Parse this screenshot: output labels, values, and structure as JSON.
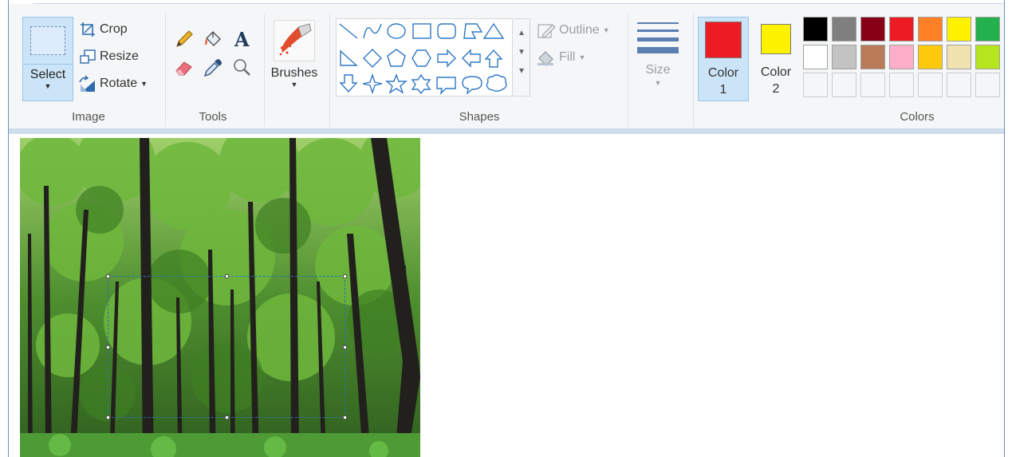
{
  "ribbon": {
    "image_group": {
      "label": "Image",
      "select_label": "Select",
      "crop_label": "Crop",
      "resize_label": "Resize",
      "rotate_label": "Rotate"
    },
    "tools_group": {
      "label": "Tools"
    },
    "brushes_label": "Brushes",
    "shapes_group": {
      "label": "Shapes",
      "outline_label": "Outline",
      "fill_label": "Fill"
    },
    "size_label": "Size",
    "colors_group": {
      "label": "Colors",
      "color1_label": "Color",
      "color1_num": "1",
      "color2_label": "Color",
      "color2_num": "2",
      "color1_value": "#ed1c24",
      "color2_value": "#fff200",
      "palette_row1": [
        "#000000",
        "#7f7f7f",
        "#880015",
        "#ed1c24",
        "#ff7f27",
        "#fff200",
        "#22b14c"
      ],
      "palette_row2": [
        "#ffffff",
        "#c3c3c3",
        "#b97a57",
        "#ffaec9",
        "#ffc90e",
        "#efe4b0",
        "#b5e61d"
      ]
    }
  },
  "icons": [
    "crop-icon",
    "resize-icon",
    "rotate-icon",
    "pencil-icon",
    "fill-bucket-icon",
    "text-icon",
    "eraser-icon",
    "color-picker-icon",
    "magnifier-icon",
    "outline-icon",
    "fill-icon",
    "size-lines-icon"
  ]
}
